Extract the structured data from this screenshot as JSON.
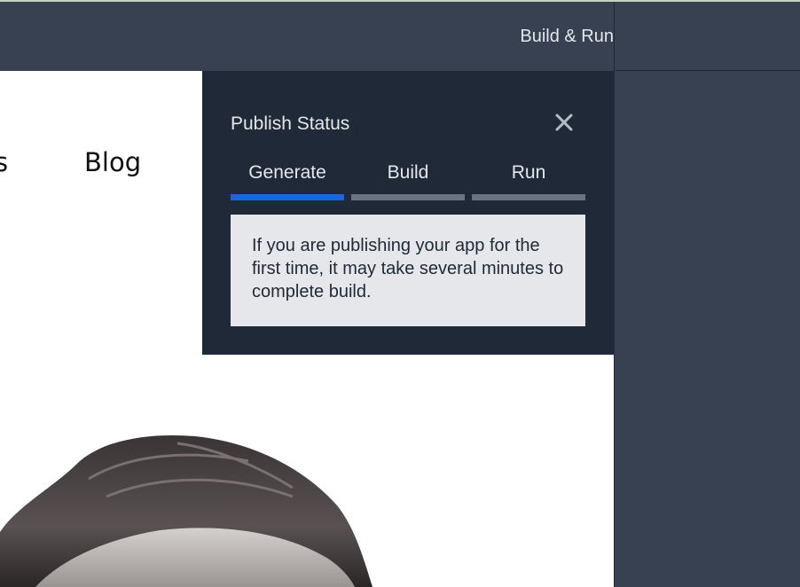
{
  "header": {
    "action_label": "Build & Run"
  },
  "site_nav": {
    "partial_item": "s",
    "blog_label": "Blog"
  },
  "publish_status": {
    "title": "Publish Status",
    "close_icon": "close-icon",
    "tabs": [
      {
        "label": "Generate",
        "active": true
      },
      {
        "label": "Build",
        "active": false
      },
      {
        "label": "Run",
        "active": false
      }
    ],
    "notice": "If you are publishing your app for the first time, it may take several minutes to complete build."
  },
  "colors": {
    "topbar": "#374151",
    "popover_bg": "#1f2937",
    "active_tab": "#1d63e5",
    "inactive_tab": "#6b7280",
    "notice_bg": "#e5e7eb"
  }
}
